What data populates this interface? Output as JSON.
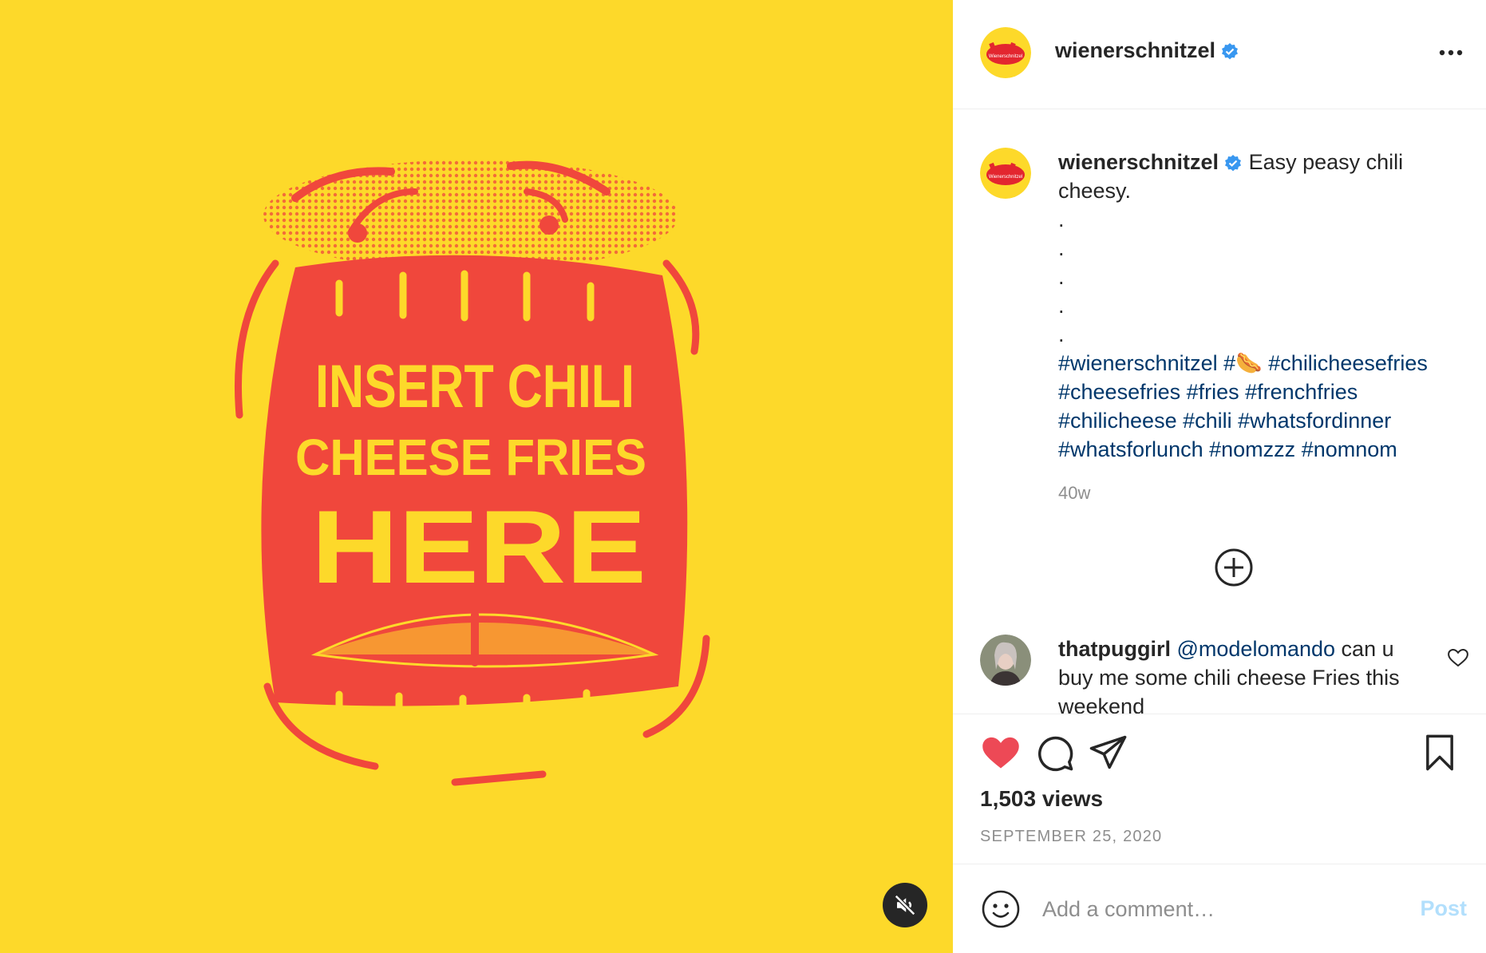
{
  "colors": {
    "media_background": "#FDD92A",
    "artwork_red": "#F0473C",
    "artwork_text": "#FDD92A",
    "verified_blue": "#3897F0",
    "link": "#00376B",
    "heart_red": "#ED4956",
    "post_button_disabled": "#B2DFFC"
  },
  "media": {
    "artwork_text": [
      "INSERT CHILI",
      "CHEESE FRIES",
      "HERE"
    ],
    "mute_icon": "speaker-muted-icon"
  },
  "post": {
    "username": "wienerschnitzel",
    "avatar_logo_text": "Wienerschnitzel",
    "verified_icon": "verified-badge-icon",
    "more_icon": "more-horizontal-icon",
    "caption": {
      "username": "wienerschnitzel",
      "text": "Easy peasy chili cheesy.",
      "dots": [
        ".",
        ".",
        ".",
        ".",
        "."
      ],
      "hashtags": [
        "#wienerschnitzel",
        "#🌭",
        "#chilicheesefries",
        "#cheesefries",
        "#fries",
        "#frenchfries",
        "#chilicheese",
        "#chili",
        "#whatsfordinner",
        "#whatsforlunch",
        "#nomzzz",
        "#nomnom"
      ],
      "time_ago": "40w"
    },
    "load_more_icon": "plus-circle-icon",
    "comments": [
      {
        "username": "thatpuggirl",
        "mention": "@modelomando",
        "text": "can u buy me some chili cheese Fries this weekend"
      }
    ],
    "actions": {
      "like_icon": "heart-filled-icon",
      "comment_icon": "comment-icon",
      "share_icon": "paper-plane-icon",
      "save_icon": "bookmark-icon"
    },
    "views": "1,503 views",
    "date": "SEPTEMBER 25, 2020"
  },
  "add_comment": {
    "emoji_icon": "emoji-icon",
    "placeholder": "Add a comment…",
    "post_label": "Post"
  }
}
